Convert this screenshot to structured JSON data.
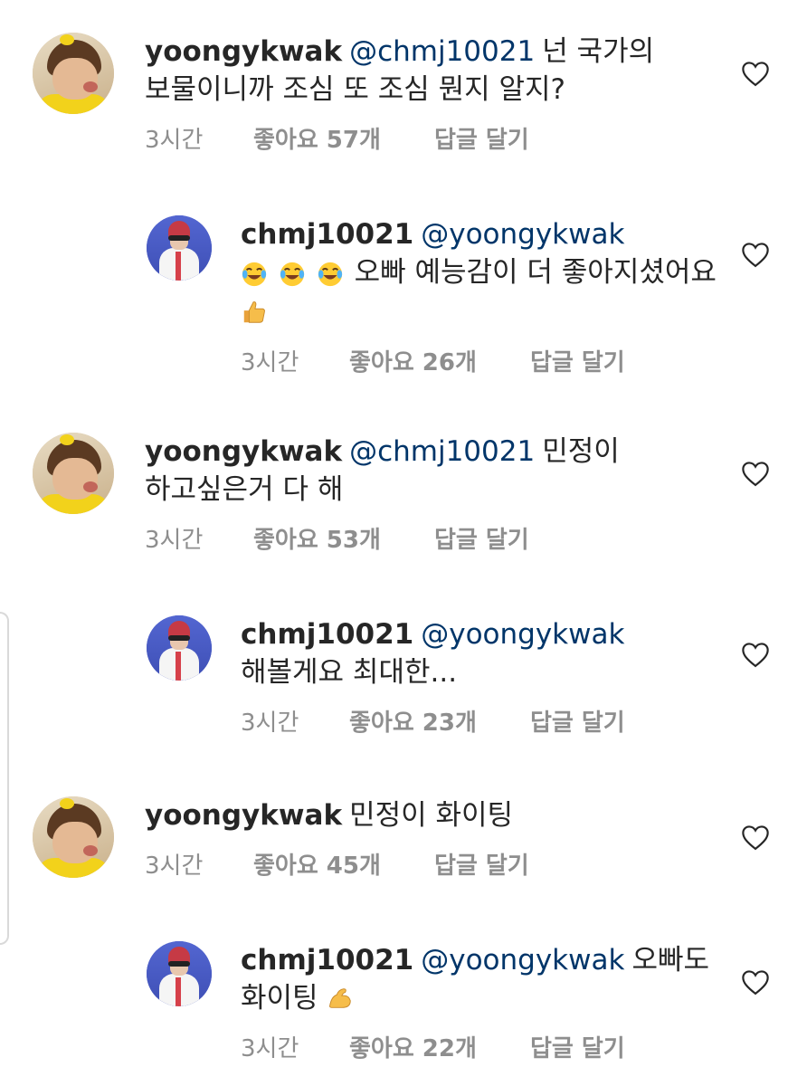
{
  "comments": [
    {
      "username": "yoongykwak",
      "mention": "@chmj10021",
      "text": "넌 국가의 보물이니까 조심 또 조심 뭔지 알지?",
      "time": "3시간",
      "likes": "좋아요 57개",
      "reply": "답글 달기"
    },
    {
      "username": "chmj10021",
      "mention": "@yoongykwak",
      "text": "오빠 예능감이 더 좋아지셨어요",
      "time": "3시간",
      "likes": "좋아요 26개",
      "reply": "답글 달기"
    },
    {
      "username": "yoongykwak",
      "mention": "@chmj10021",
      "text": "민정이 하고싶은거 다 해",
      "time": "3시간",
      "likes": "좋아요 53개",
      "reply": "답글 달기"
    },
    {
      "username": "chmj10021",
      "mention": "@yoongykwak",
      "text": "해볼게요 최대한...",
      "time": "3시간",
      "likes": "좋아요 23개",
      "reply": "답글 달기"
    },
    {
      "username": "yoongykwak",
      "mention": "",
      "text": "민정이 화이팅",
      "time": "3시간",
      "likes": "좋아요 45개",
      "reply": "답글 달기"
    },
    {
      "username": "chmj10021",
      "mention": "@yoongykwak",
      "text": "오빠도 화이팅",
      "time": "3시간",
      "likes": "좋아요 22개",
      "reply": "답글 달기"
    }
  ],
  "icons": {
    "like": "heart-outline-icon",
    "laugh": "face-with-tears-of-joy-emoji",
    "thumbs": "thumbs-up-emoji",
    "muscle": "flexed-biceps-emoji"
  },
  "colors": {
    "mention": "#003569",
    "meta": "#8e8e8e",
    "text": "#262626"
  }
}
